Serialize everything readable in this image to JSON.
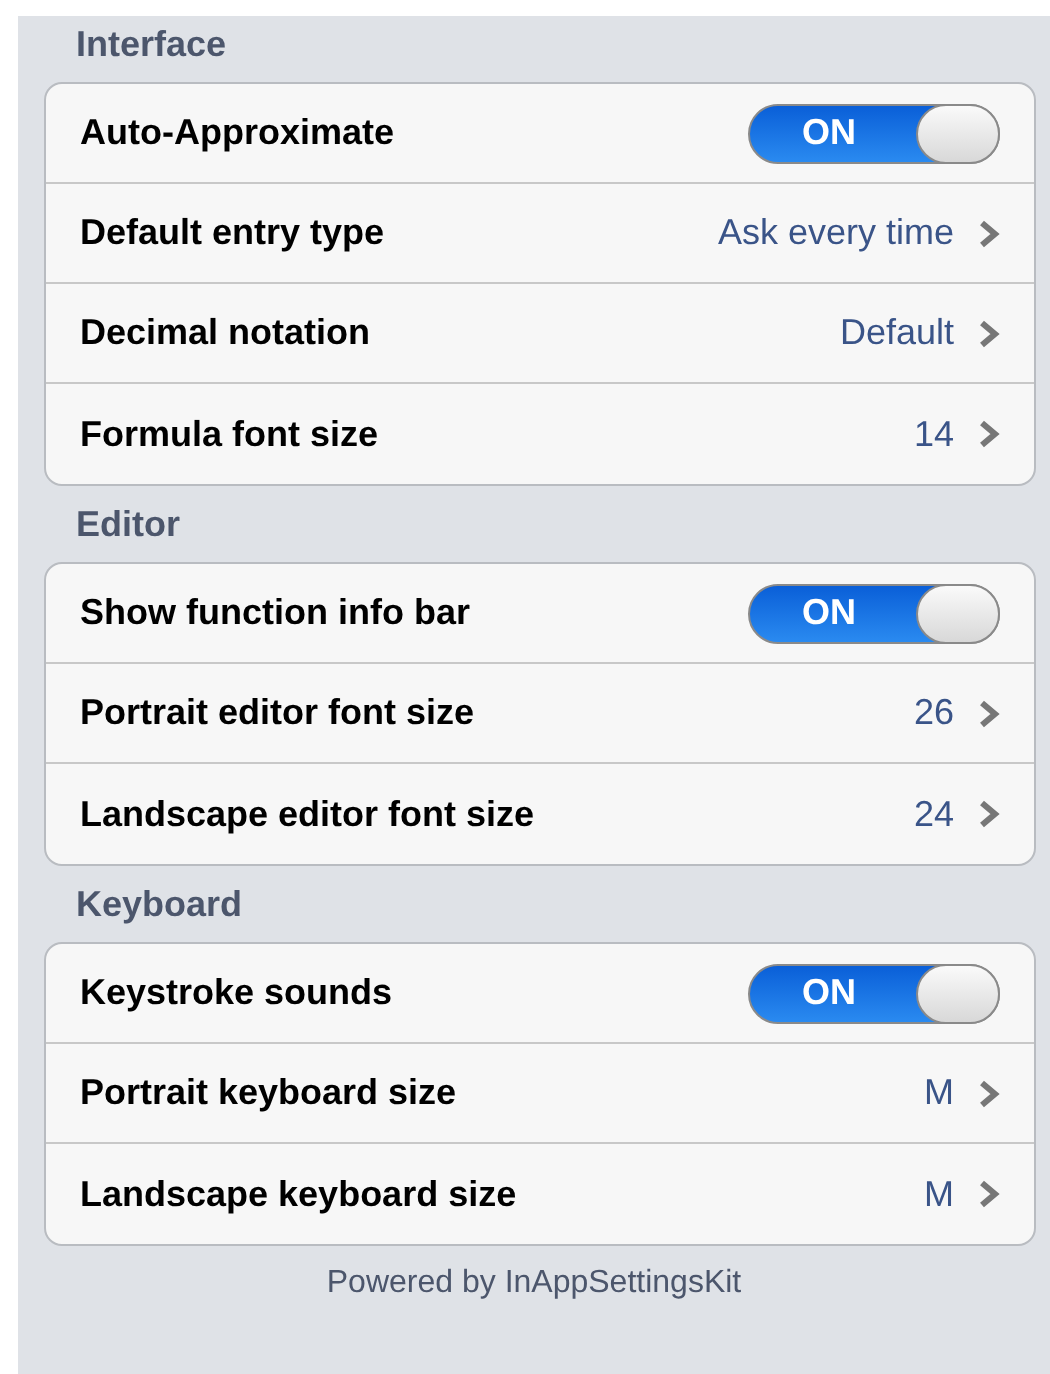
{
  "sections": [
    {
      "header": "Interface",
      "rows": [
        {
          "kind": "toggle",
          "label": "Auto-Approximate",
          "on": true,
          "toggle_text": "ON"
        },
        {
          "kind": "value",
          "label": "Default entry type",
          "value": "Ask every time"
        },
        {
          "kind": "value",
          "label": "Decimal notation",
          "value": "Default"
        },
        {
          "kind": "value",
          "label": "Formula font size",
          "value": "14"
        }
      ]
    },
    {
      "header": "Editor",
      "rows": [
        {
          "kind": "toggle",
          "label": "Show function info bar",
          "on": true,
          "toggle_text": "ON"
        },
        {
          "kind": "value",
          "label": "Portrait editor font size",
          "value": "26"
        },
        {
          "kind": "value",
          "label": "Landscape editor font size",
          "value": "24"
        }
      ]
    },
    {
      "header": "Keyboard",
      "rows": [
        {
          "kind": "toggle",
          "label": "Keystroke sounds",
          "on": true,
          "toggle_text": "ON"
        },
        {
          "kind": "value",
          "label": "Portrait keyboard size",
          "value": "M"
        },
        {
          "kind": "value",
          "label": "Landscape keyboard size",
          "value": "M"
        }
      ]
    }
  ],
  "footer": "Powered by InAppSettingsKit"
}
